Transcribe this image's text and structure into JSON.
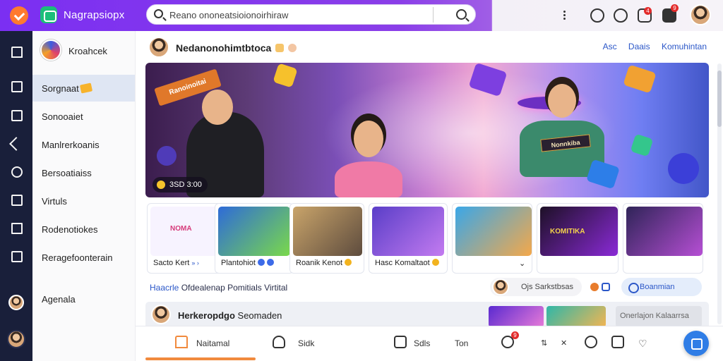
{
  "topbar": {
    "app_name": "Nagrapsiopx",
    "search_value": "Reano ononeatsioionoirhiraw",
    "notif_badge": "4",
    "msg_badge": "9"
  },
  "sidebar": {
    "profile_name": "Kroahcek",
    "items": [
      {
        "label": "Sorgnaat",
        "active": true
      },
      {
        "label": "Sonooaiet"
      },
      {
        "label": "Manlrerkoanis"
      },
      {
        "label": "Bersoatiaiss"
      },
      {
        "label": "Virtuls"
      },
      {
        "label": "Rodenotiokes"
      },
      {
        "label": "Reragefoonterain"
      }
    ],
    "bottom_label": "Agenala"
  },
  "channel": {
    "name": "Nedanonohimtbtoca",
    "links": [
      "Asc",
      "Daais",
      "Komuhintan"
    ]
  },
  "banner": {
    "ribbon": "Ranoinoitai",
    "sign": "Nonnkiba",
    "counter": "3SD 3:00"
  },
  "cards": [
    {
      "caption": "Sacto Kert",
      "thumb_text": "NOMA",
      "icon": "arrows-icon",
      "color_a": "#f7f3ff",
      "color_b": "#ffe9d2"
    },
    {
      "caption": "Plantohiot",
      "thumb_text": "",
      "icon": "live-icon",
      "color_a": "#2e6bd8",
      "color_b": "#7ad94a"
    },
    {
      "caption": "Roanik Kenot",
      "thumb_text": "",
      "icon": "coin-icon",
      "color_a": "#c9a46a",
      "color_b": "#5e4c3e"
    },
    {
      "caption": "Hasc Komaltaot",
      "thumb_text": "",
      "icon": "coin-icon",
      "color_a": "#5a3ec8",
      "color_b": "#c37bf0"
    },
    {
      "caption": "",
      "thumb_text": "",
      "icon": "chevron-down-icon",
      "color_a": "#3aa7e8",
      "color_b": "#f4a84a"
    },
    {
      "caption": "",
      "thumb_text": "KOMITIKA",
      "icon": "",
      "color_a": "#1d1026",
      "color_b": "#8a2ad6"
    },
    {
      "caption": "",
      "thumb_text": "",
      "icon": "",
      "color_a": "#2f2458",
      "color_b": "#b64fd4"
    }
  ],
  "section": {
    "title_accent": "Haacrle",
    "title_rest": "Ofdealenap Pomitials Virtital",
    "pill_a": "Ojs Sarkstbsas",
    "pill_c": "Boanmian"
  },
  "feed": {
    "title_bold": "Herkeropdgo",
    "title_rest": "Seomaden",
    "box_text": "Onerlajon Kalaarrsa"
  },
  "bottombar": {
    "items": [
      "Naitamal",
      "Sidk",
      "Sdls",
      "Ton"
    ],
    "badge": "9",
    "active_index": 0
  },
  "colors": {
    "accent": "#7b2ff2",
    "link": "#2b57c8",
    "fab": "#2f7de6",
    "active_bar": "#f18a3d",
    "rail": "#191f3a"
  }
}
